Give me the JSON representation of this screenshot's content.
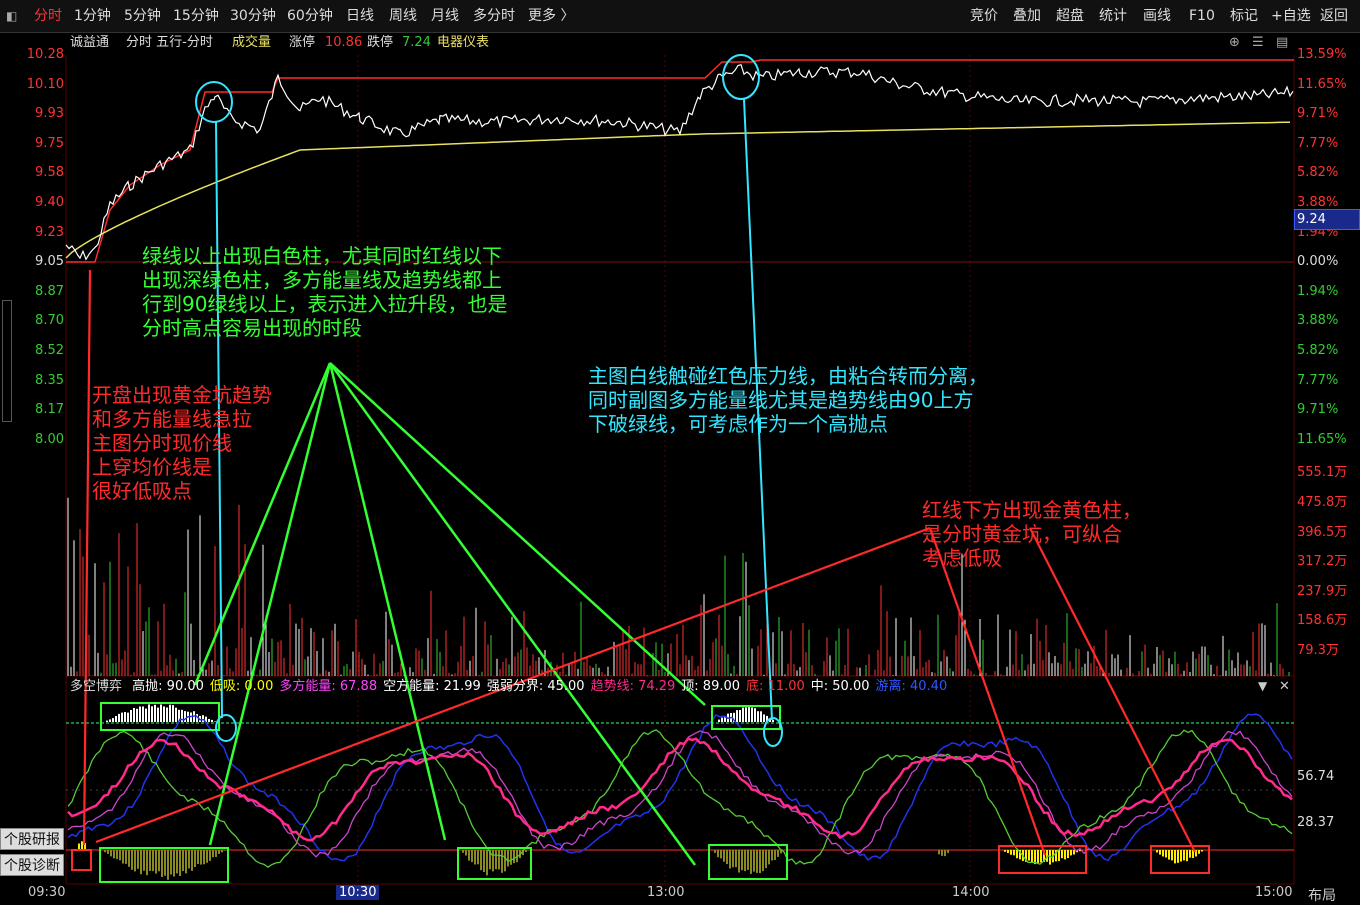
{
  "toolbar": {
    "tabs": [
      "分时",
      "1分钟",
      "5分钟",
      "15分钟",
      "30分钟",
      "60分钟",
      "日线",
      "周线",
      "月线",
      "多分时",
      "更多"
    ],
    "right": [
      "竞价",
      "叠加",
      "超盘",
      "统计",
      "画线",
      "F10",
      "标记",
      "+自选",
      "返回"
    ]
  },
  "header": {
    "name": "诚益通",
    "view": "分时 五行-分时",
    "volume_label": "成交量",
    "limit_up_label": "涨停",
    "limit_up_value": "10.86",
    "limit_down_label": "跌停",
    "limit_down_value": "7.24",
    "sector": "电器仪表"
  },
  "left_axis": [
    "10.28",
    "10.10",
    "9.93",
    "9.75",
    "9.58",
    "9.40",
    "9.23",
    "9.05",
    "8.87",
    "8.70",
    "8.52",
    "8.35",
    "8.17",
    "8.00"
  ],
  "right_axis": [
    "13.59%",
    "11.65%",
    "9.71%",
    "7.77%",
    "5.82%",
    "3.88%",
    "1.94%",
    "0.00%",
    "1.94%",
    "3.88%",
    "5.82%",
    "7.77%",
    "9.71%",
    "11.65%",
    "555.1万",
    "475.8万",
    "396.5万",
    "317.2万",
    "237.9万",
    "158.6万",
    "79.3万"
  ],
  "last_price_tag": "9.24",
  "sub_right_axis": [
    "56.74",
    "28.37"
  ],
  "indicator": {
    "name": "多空博弈",
    "items": [
      {
        "label": "高抛: 90.00",
        "color": "#ffffff"
      },
      {
        "label": "低吸: 0.00",
        "color": "#ffff00"
      },
      {
        "label": "多方能量: 67.88",
        "color": "#ff44ff"
      },
      {
        "label": "空方能量: 21.99",
        "color": "#ffffff"
      },
      {
        "label": "强弱分界: 45.00",
        "color": "#ffffff"
      },
      {
        "label": "趋势线: 74.29",
        "color": "#ff2a8a"
      },
      {
        "label": "顶: 89.00",
        "color": "#ffffff"
      },
      {
        "label": "底: 11.00",
        "color": "#ff3333"
      },
      {
        "label": "中: 50.00",
        "color": "#ffffff"
      },
      {
        "label": "游离: 40.40",
        "color": "#3355ff"
      }
    ]
  },
  "side_buttons": [
    "个股研报",
    "个股诊断"
  ],
  "time_axis": [
    "09:30",
    "10:30",
    "13:00",
    "14:00",
    "15:00"
  ],
  "layout_button": "布局",
  "annotations": {
    "green_text": "绿线以上出现白色柱，尤其同时红线以下\n出现深绿色柱，多方能量线及趋势线都上\n行到90绿线以上，表示进入拉升段，也是\n分时高点容易出现的时段",
    "red_text_1": "开盘出现黄金坑趋势\n和多方能量线急拉\n主图分时现价线\n上穿均价线是\n很好低吸点",
    "cyan_text": "主图白线触碰红色压力线，由粘合转而分离，\n同时副图多方能量线尤其是趋势线由90上方\n下破绿线，可考虑作为一个高抛点",
    "red_text_2": "红线下方出现金黄色柱，\n是分时黄金坑，可纵合\n考虑低吸"
  },
  "colors": {
    "price": "#ffffff",
    "avg": "#e8e060",
    "resist": "#ff2a2a",
    "green_ann": "#33ff33",
    "cyan_ann": "#33e6ff",
    "red_ann": "#ff2a2a"
  }
}
